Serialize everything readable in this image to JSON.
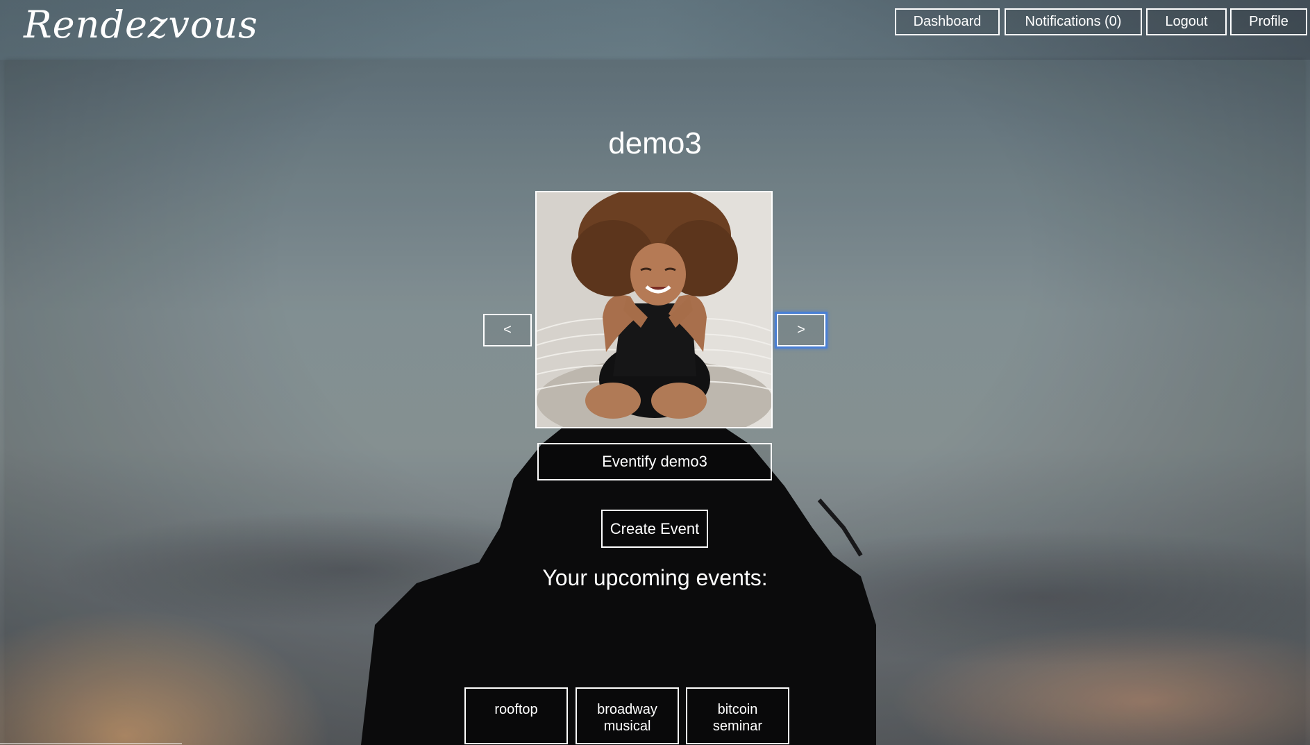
{
  "app": {
    "logo_text": "Rendezvous"
  },
  "nav": {
    "dashboard": "Dashboard",
    "notifications": "Notifications (0)",
    "logout": "Logout",
    "profile": "Profile"
  },
  "profile": {
    "username": "demo3",
    "prev_label": "<",
    "next_label": ">",
    "eventify_label": "Eventify demo3"
  },
  "events": {
    "create_label": "Create Event",
    "section_title": "Your upcoming events:",
    "items": [
      {
        "name": "rooftop"
      },
      {
        "name": "broadway musical"
      },
      {
        "name": "bitcoin seminar"
      }
    ]
  }
}
